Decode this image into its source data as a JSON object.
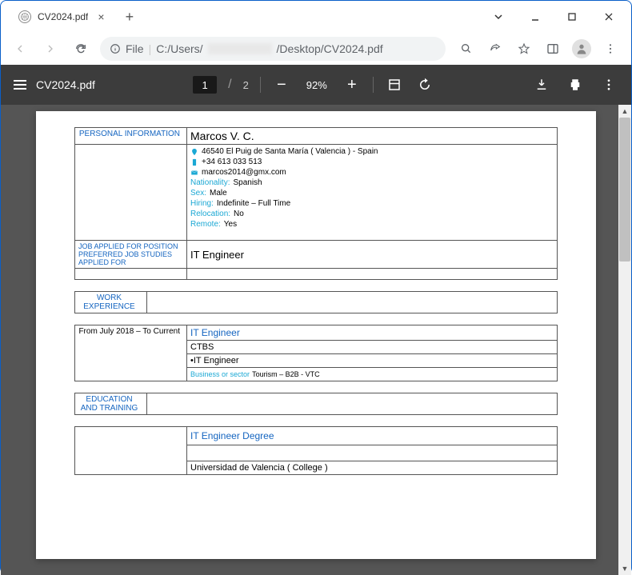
{
  "browser": {
    "tab_title": "CV2024.pdf",
    "url_prefix": "File",
    "url_path_start": "C:/Users/",
    "url_path_end": "/Desktop/CV2024.pdf"
  },
  "pdf_toolbar": {
    "filename": "CV2024.pdf",
    "current_page": "1",
    "page_separator": "/",
    "total_pages": "2",
    "zoom": "92%"
  },
  "cv": {
    "personal_info_label": "PERSONAL INFORMATION",
    "name": "Marcos V. C.",
    "address": "46540 El Puig de Santa María ( Valencia ) - Spain",
    "phone": "+34 613 033 513",
    "email": "marcos2014@gmx.com",
    "nationality_label": "Nationality:",
    "nationality": "Spanish",
    "sex_label": "Sex:",
    "sex": "Male",
    "hiring_label": "Hiring:",
    "hiring": "Indefinite  – Full Time",
    "relocation_label": "Relocation:",
    "relocation": "No",
    "remote_label": "Remote:",
    "remote": "Yes",
    "job_section_label": "JOB APPLIED FOR POSITION\nPREFERRED JOB STUDIES APPLIED FOR",
    "job_applied": "IT Engineer",
    "work_exp_label": "WORK EXPERIENCE",
    "exp_period": "From July 2018 – To Current",
    "exp_title": "IT  Engineer",
    "exp_company": "CTBS",
    "exp_role": "•IT Engineer",
    "exp_sector_label": "Business or sector",
    "exp_sector": "Tourism – B2B - VTC",
    "education_label": "EDUCATION AND TRAINING",
    "degree": "IT Engineer Degree",
    "university": "Universidad de Valencia ( College )"
  }
}
